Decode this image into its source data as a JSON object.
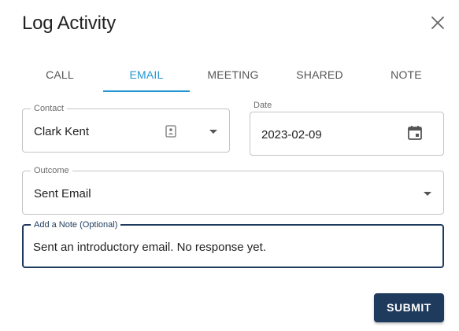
{
  "dialog": {
    "title": "Log Activity",
    "close_icon": "close-icon"
  },
  "tabs": [
    {
      "label": "CALL",
      "active": false
    },
    {
      "label": "EMAIL",
      "active": true
    },
    {
      "label": "MEETING",
      "active": false
    },
    {
      "label": "SHARED",
      "active": false
    },
    {
      "label": "NOTE",
      "active": false
    }
  ],
  "form": {
    "contact": {
      "label": "Contact",
      "value": "Clark Kent",
      "icon": "contact-card-icon",
      "dropdown_icon": "caret-down-icon"
    },
    "date": {
      "label": "Date",
      "value": "2023-02-09",
      "icon": "calendar-icon"
    },
    "outcome": {
      "label": "Outcome",
      "value": "Sent Email",
      "dropdown_icon": "caret-down-icon"
    },
    "note": {
      "label": "Add a Note (Optional)",
      "value": "Sent an introductory email. No response yet."
    }
  },
  "actions": {
    "submit_label": "SUBMIT"
  },
  "colors": {
    "accent": "#2196d3",
    "primary": "#1e3a5c"
  }
}
